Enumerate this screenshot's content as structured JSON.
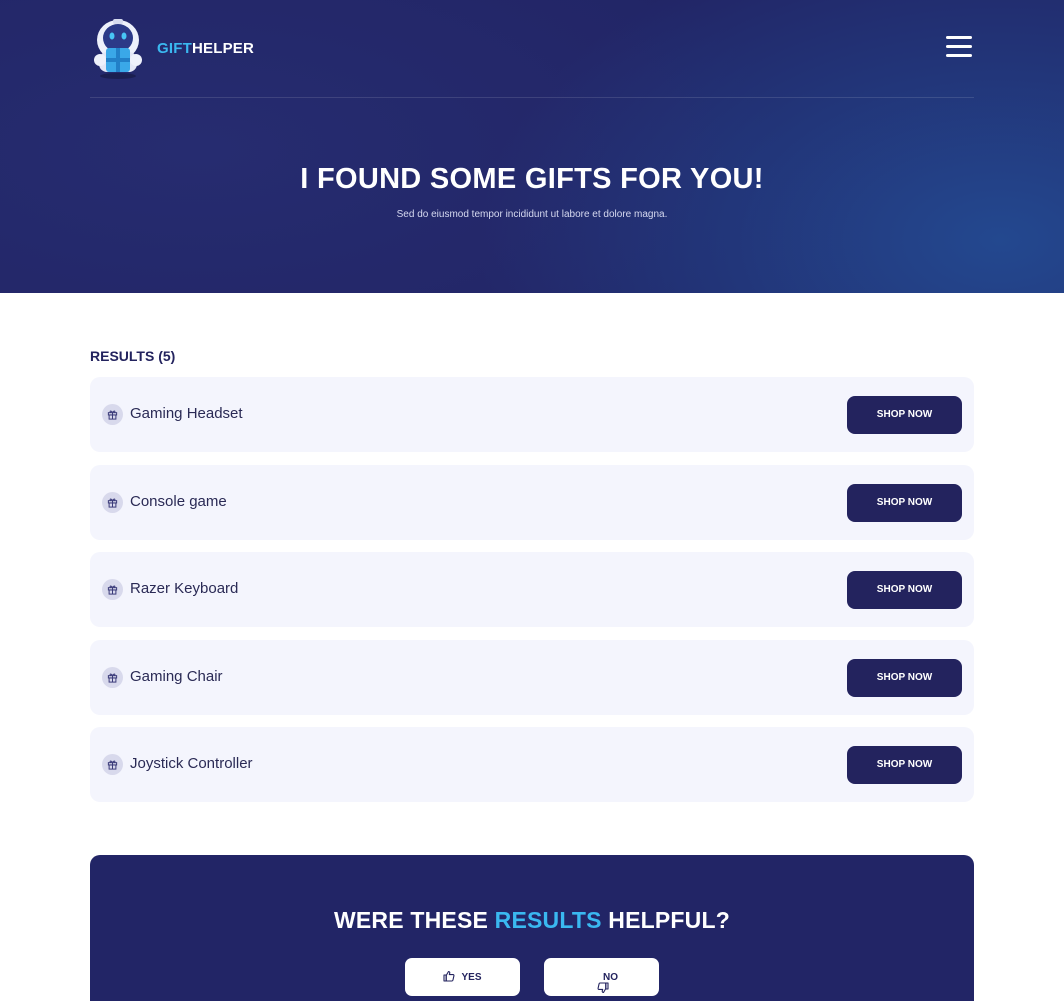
{
  "header": {
    "brand_part1": "GIFT",
    "brand_part2": "HELPER",
    "logo_icon": "robot-gift-logo",
    "menu_icon": "hamburger-menu-icon"
  },
  "hero": {
    "title": "I FOUND SOME GIFTS FOR YOU!",
    "subtitle": "Sed do eiusmod tempor incididunt ut labore et dolore magna."
  },
  "results": {
    "heading": "RESULTS (5)",
    "items": [
      {
        "name": "Gaming Headset",
        "button": "SHOP NOW"
      },
      {
        "name": "Console game",
        "button": "SHOP NOW"
      },
      {
        "name": "Razer Keyboard",
        "button": "SHOP NOW"
      },
      {
        "name": "Gaming Chair",
        "button": "SHOP NOW"
      },
      {
        "name": "Joystick Controller",
        "button": "SHOP NOW"
      }
    ]
  },
  "feedback": {
    "title_part1": "WERE THESE ",
    "title_highlight": "RESULTS",
    "title_part2": " HELPFUL?",
    "yes_label": "YES",
    "no_label": "NO"
  },
  "colors": {
    "primary_dark": "#23235e",
    "accent": "#3ab8f0",
    "card_bg": "#f4f5fd"
  }
}
